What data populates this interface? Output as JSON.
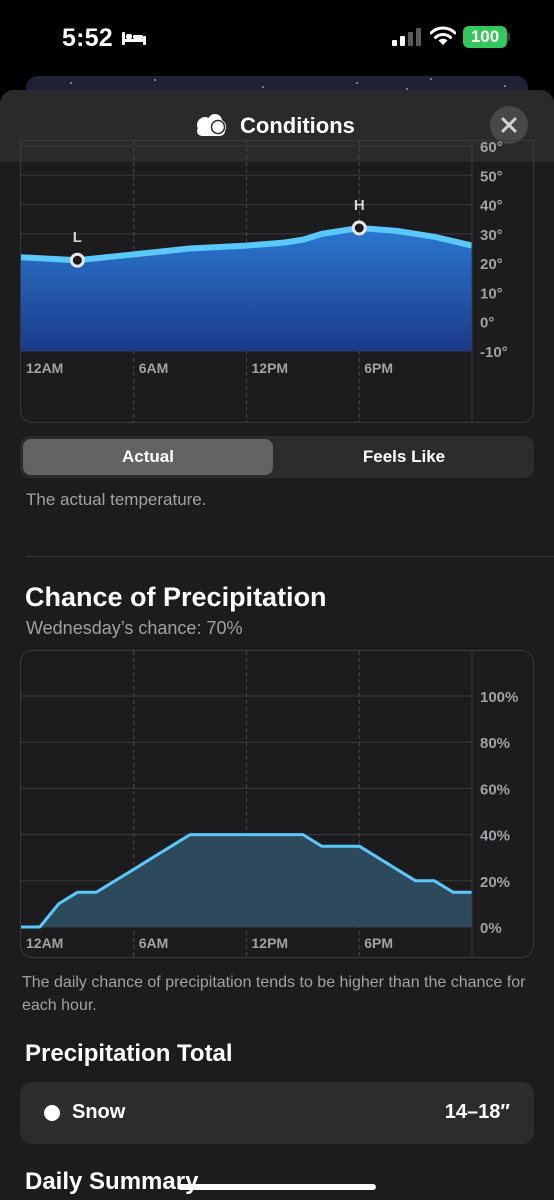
{
  "status_bar": {
    "time": "5:52",
    "sleep_icon": "bed-icon",
    "battery": "100",
    "battery_color": "#34c759"
  },
  "header": {
    "title": "Conditions",
    "icon": "cloud-icon",
    "close_icon": "close-icon"
  },
  "temperature": {
    "chart_data": {
      "type": "area",
      "x_labels": [
        "12AM",
        "6AM",
        "12PM",
        "6PM"
      ],
      "y_labels": [
        "60°",
        "50°",
        "40°",
        "30°",
        "20°",
        "10°",
        "0°",
        "-10°"
      ],
      "ylim": [
        -10,
        60
      ],
      "hours": [
        0,
        3,
        6,
        9,
        12,
        14,
        15,
        16,
        18,
        20,
        22,
        24
      ],
      "values": [
        22,
        21,
        23,
        25,
        26,
        27,
        28,
        30,
        32,
        31,
        29,
        26
      ],
      "low": {
        "label": "L",
        "hour": 3,
        "value": 21
      },
      "high": {
        "label": "H",
        "hour": 18,
        "value": 32
      },
      "line_color": "#5ac8fa",
      "fill_top": "#2a78d0",
      "fill_bottom": "#1c3a8a"
    },
    "tabs": [
      {
        "label": "Actual",
        "selected": true
      },
      {
        "label": "Feels Like",
        "selected": false
      }
    ],
    "description": "The actual temperature."
  },
  "precipitation": {
    "title": "Chance of Precipitation",
    "subtitle": "Wednesday’s chance: 70%",
    "chart_data": {
      "type": "area",
      "x_labels": [
        "12AM",
        "6AM",
        "12PM",
        "6PM"
      ],
      "y_labels": [
        "100%",
        "80%",
        "60%",
        "40%",
        "20%",
        "0%"
      ],
      "ylim": [
        0,
        100
      ],
      "hours": [
        0,
        1,
        2,
        3,
        4,
        5,
        6,
        7,
        8,
        9,
        10,
        11,
        12,
        13,
        14,
        15,
        16,
        17,
        18,
        19,
        20,
        21,
        22,
        23,
        24
      ],
      "values": [
        0,
        0,
        10,
        15,
        15,
        20,
        25,
        30,
        35,
        40,
        40,
        40,
        40,
        40,
        40,
        40,
        35,
        35,
        35,
        30,
        25,
        20,
        20,
        15,
        15
      ],
      "line_color": "#5ac8fa",
      "fill_color": "#2c4a5c"
    },
    "footnote": "The daily chance of precipitation tends to be higher than the chance for each hour."
  },
  "total": {
    "title": "Precipitation Total",
    "label": "Snow",
    "value": "14–18″"
  },
  "summary": {
    "title": "Daily Summary"
  }
}
